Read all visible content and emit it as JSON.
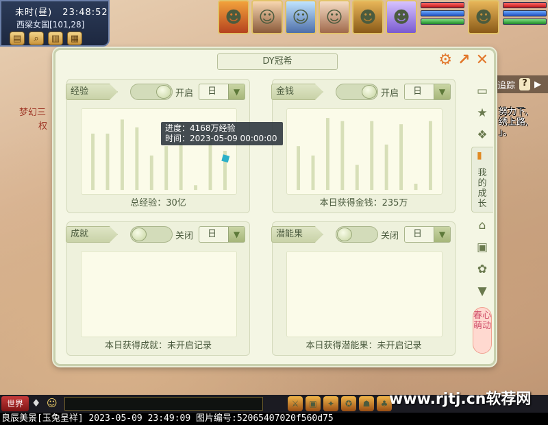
{
  "location": {
    "time_period": "未时(昼)",
    "clock": "23:48:52",
    "place": "西梁女国[101,28]"
  },
  "top_right": {
    "track_label": "追踪",
    "help": "?",
    "quest_lines": [
      "努力下,",
      "绣上路,",
      "」。"
    ]
  },
  "left_text": {
    "line1": "梦幻三",
    "line2": "权"
  },
  "dialog": {
    "title": "DY冠希",
    "panels": {
      "exp": {
        "tag": "经验",
        "toggle_state": "开启",
        "period": "日",
        "footer": "总经验：30亿",
        "chart_data": {
          "type": "bar",
          "values": [
            0.72,
            0.72,
            0.9,
            0.8,
            0.44,
            0.56,
            0.86,
            0.06,
            0.84,
            0.5
          ]
        }
      },
      "money": {
        "tag": "金钱",
        "toggle_state": "开启",
        "period": "日",
        "footer": "本日获得金钱：235万",
        "chart_data": {
          "type": "bar",
          "values": [
            0.56,
            0.44,
            0.92,
            0.88,
            0.32,
            0.88,
            0.58,
            0.84,
            0.08,
            0.88
          ]
        }
      },
      "achievement": {
        "tag": "成就",
        "toggle_state": "关闭",
        "period": "日",
        "footer": "本日获得成就：未开启记录"
      },
      "potential": {
        "tag": "潜能果",
        "toggle_state": "关闭",
        "period": "日",
        "footer": "本日获得潜能果：未开启记录"
      }
    },
    "tooltip": {
      "line1": "进度：4168万经验",
      "line2": "时间：2023-05-09 00:00:00"
    },
    "tabs": {
      "active_label": "我的成长",
      "spring_label": "春心萌动"
    }
  },
  "bottom": {
    "channel": "世界",
    "watermark": "www.rjtj.cn软荐网",
    "status_line": "良辰美景[玉兔呈祥] 2023-05-09 23:49:09 图片编号:52065407020f560d75"
  },
  "colors": {
    "accent_orange": "#e2772b",
    "panel_bg": "#eef1dc",
    "bar_fill": "#d7dfb8"
  }
}
